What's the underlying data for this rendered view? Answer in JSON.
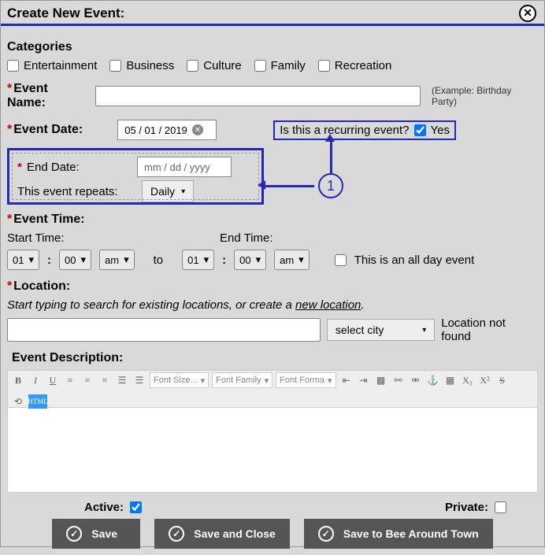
{
  "title": "Create New Event:",
  "categories_heading": "Categories",
  "categories": [
    "Entertainment",
    "Business",
    "Culture",
    "Family",
    "Recreation"
  ],
  "event_name": {
    "label": "Event Name:",
    "hint": "(Example: Birthday Party)",
    "value": ""
  },
  "event_date": {
    "label": "Event Date:",
    "value": "05 / 01 / 2019"
  },
  "recurring_q": {
    "label": "Is this a recurring event?",
    "yes": "Yes"
  },
  "end_date": {
    "label": "End Date:",
    "placeholder": "mm / dd / yyyy"
  },
  "repeats": {
    "label": "This event repeats:",
    "value": "Daily"
  },
  "event_time_label": "Event Time:",
  "start_time_label": "Start Time:",
  "end_time_label": "End Time:",
  "to_label": "to",
  "hour_default": "01",
  "min_default": "00",
  "ampm_default": "am",
  "allday_label": "This is an all day event",
  "location_label": "Location:",
  "location_hint_a": "Start typing to search for existing locations, or create a ",
  "location_hint_b": "new location",
  "city_select": "select city",
  "location_notfound": "Location not found",
  "desc_label": "Event Description:",
  "font_size_ph": "Font Size...",
  "font_family_ph": "Font Family",
  "font_format_ph": "Font Forma",
  "active_label": "Active:",
  "private_label": "Private:",
  "btn_save": "Save",
  "btn_save_close": "Save and Close",
  "btn_save_bee": "Save to Bee Around Town",
  "annotation_number": "1"
}
